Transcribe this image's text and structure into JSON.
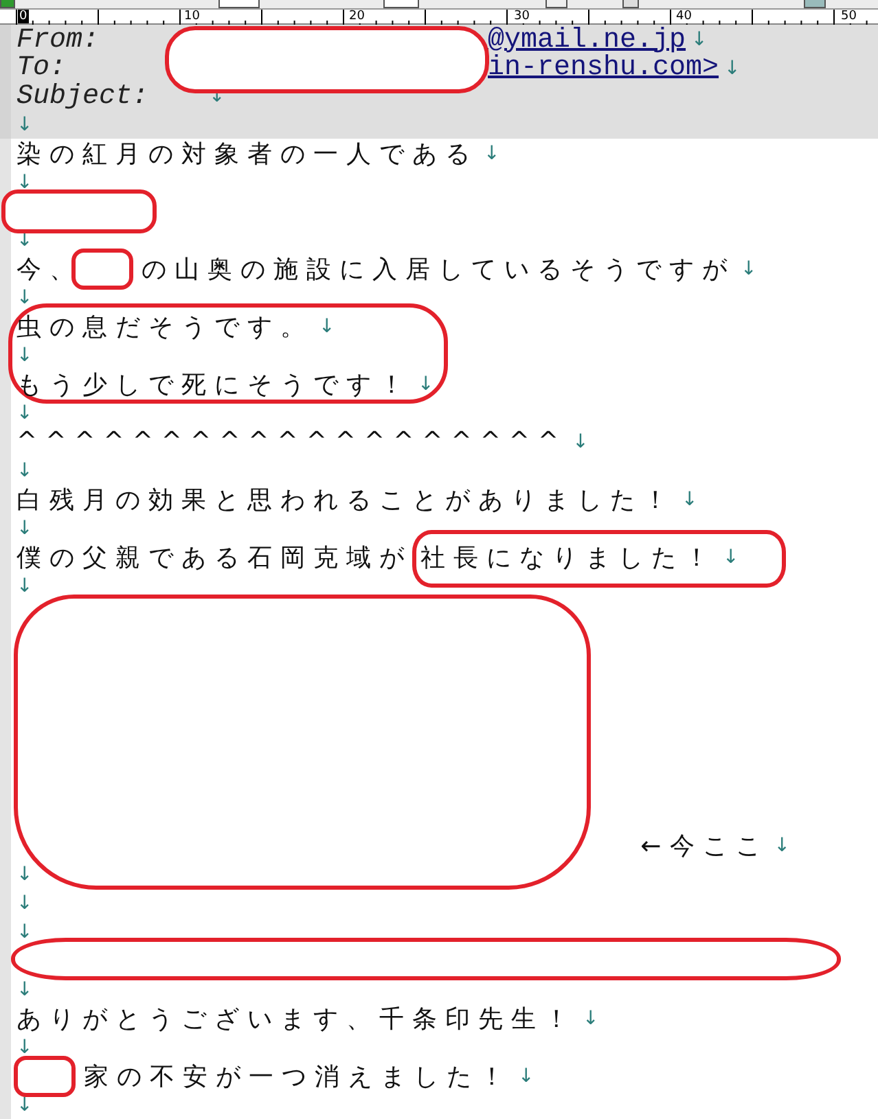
{
  "ruler": {
    "labels": [
      "0",
      "10",
      "20",
      "30",
      "40",
      "50"
    ]
  },
  "header": [
    {
      "label": "From:",
      "value": "@ymail.ne.jp",
      "eol": "↓"
    },
    {
      "label": "To:",
      "value": "in-renshu.com>",
      "eol": "↓"
    },
    {
      "label": "Subject:",
      "eol": "↓"
    },
    {
      "eol": "↓"
    }
  ],
  "body": [
    {
      "kind": "text",
      "text": "染の紅月の対象者の一人である",
      "eol": "↓"
    },
    {
      "kind": "blank",
      "eol": "↓"
    },
    {
      "kind": "redaction"
    },
    {
      "kind": "blank",
      "eol": "↓"
    },
    {
      "kind": "segments",
      "segments": [
        {
          "kind": "text",
          "text": "今、"
        },
        {
          "kind": "redaction"
        },
        {
          "kind": "text",
          "text": "の山奥の施設に入居しているそうですが"
        }
      ],
      "eol": "↓"
    },
    {
      "kind": "blank",
      "eol": "↓"
    },
    {
      "kind": "circled_group",
      "rows": [
        {
          "kind": "text",
          "text": "虫の息だそうです。",
          "eol": "↓"
        },
        {
          "kind": "blank",
          "eol": "↓"
        },
        {
          "kind": "text",
          "text": "もう少しで死にそうです！",
          "eol": "↓"
        }
      ]
    },
    {
      "kind": "blank",
      "eol": "↓"
    },
    {
      "kind": "text",
      "text": "^^^^^^^^^^^^^^^^^^^",
      "eol": "↓"
    },
    {
      "kind": "blank",
      "eol": "↓"
    },
    {
      "kind": "text",
      "text": "白残月の効果と思われることがありました！",
      "eol": "↓"
    },
    {
      "kind": "blank",
      "eol": "↓"
    },
    {
      "kind": "segments",
      "segments": [
        {
          "kind": "text",
          "text": "僕の父親である石岡克域が"
        },
        {
          "kind": "circled",
          "text": "社長になりました！",
          "eol": "↓"
        }
      ]
    },
    {
      "kind": "blank",
      "eol": "↓"
    },
    {
      "kind": "redaction_block",
      "aside": "←今ここ",
      "eol": "↓"
    },
    {
      "kind": "blank",
      "eol": "↓"
    },
    {
      "kind": "blank",
      "eol": "↓"
    },
    {
      "kind": "blank",
      "eol": "↓"
    },
    {
      "kind": "redaction_bar"
    },
    {
      "kind": "blank",
      "eol": "↓"
    },
    {
      "kind": "text",
      "text": "ありがとうございます、千条印先生！",
      "eol": "↓"
    },
    {
      "kind": "blank",
      "eol": "↓"
    },
    {
      "kind": "segments",
      "segments": [
        {
          "kind": "redaction"
        },
        {
          "kind": "text",
          "text": "家の不安が一つ消えました！"
        }
      ],
      "eol": "↓"
    },
    {
      "kind": "blank",
      "eol": "↓"
    }
  ]
}
